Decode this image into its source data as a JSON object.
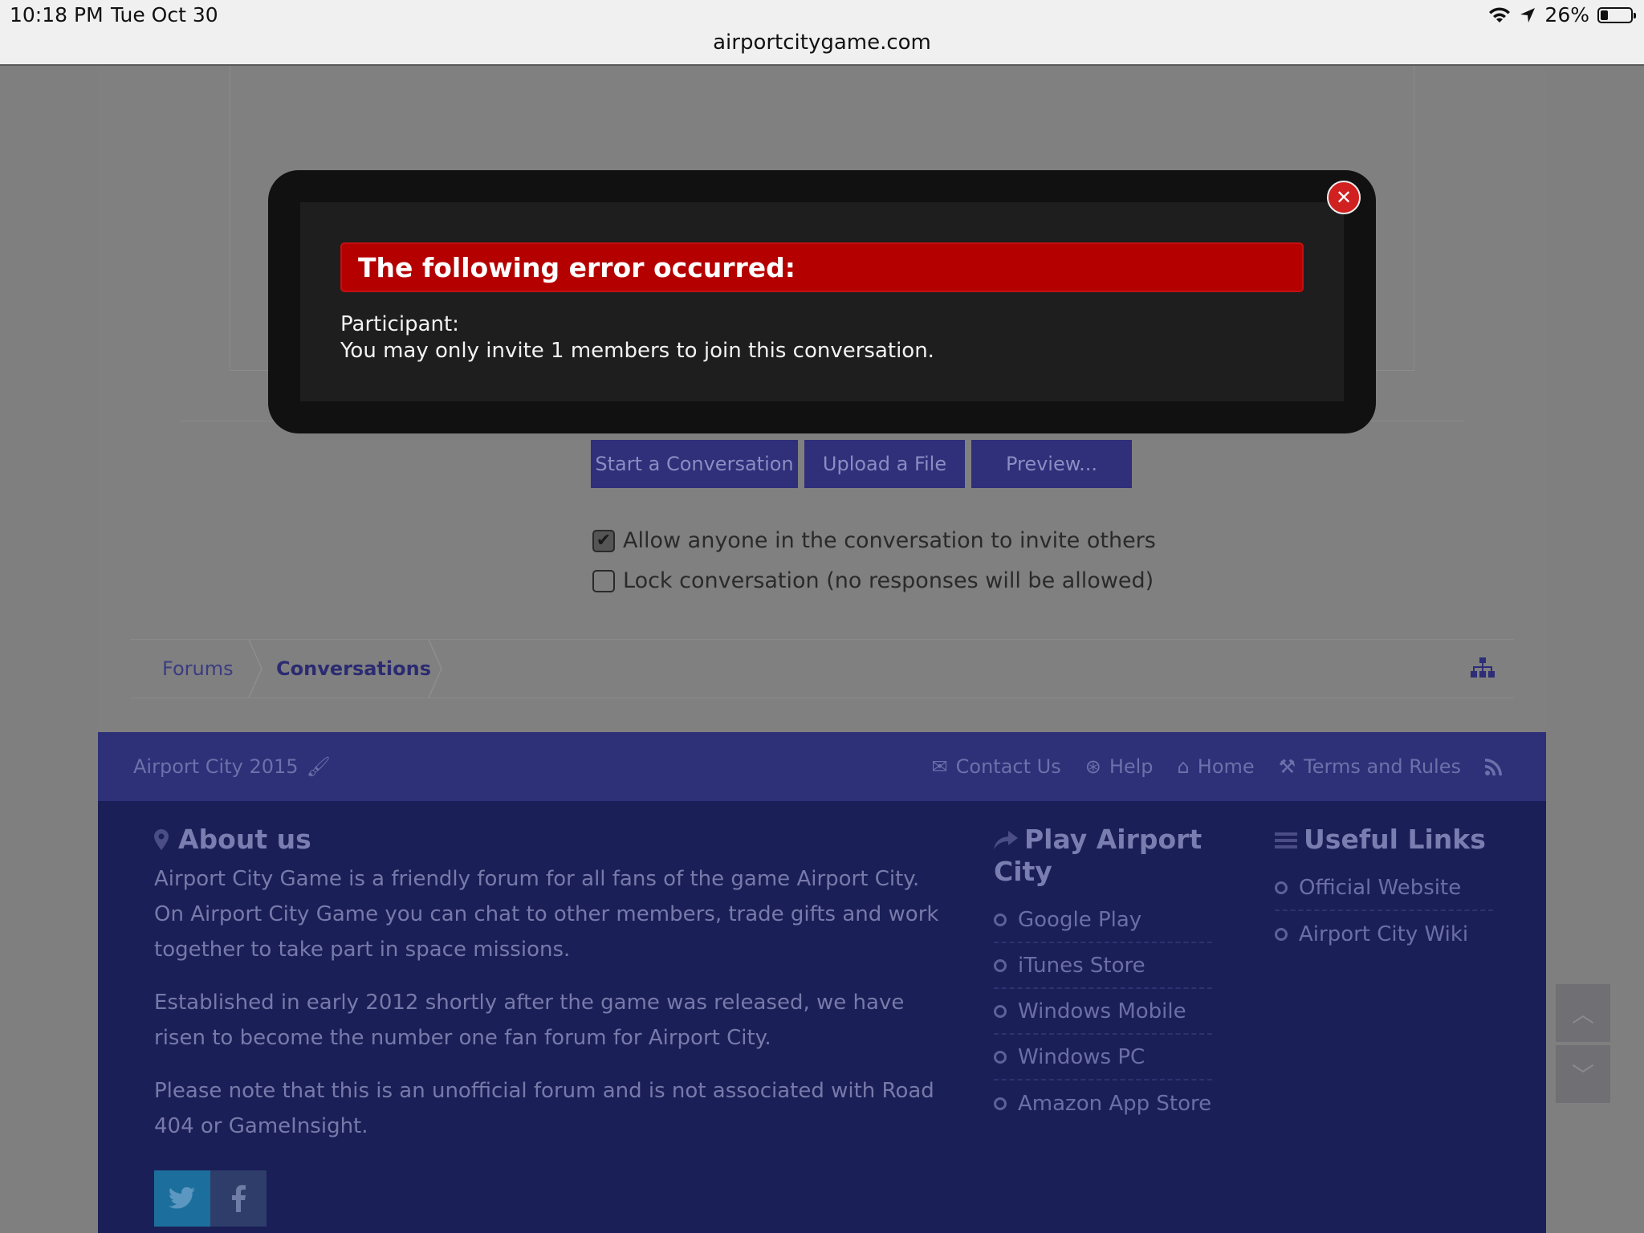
{
  "status_bar": {
    "time": "10:18 PM",
    "date": "Tue Oct 30",
    "url": "airportcitygame.com",
    "battery": "26%",
    "battery_level": 0.26
  },
  "modal": {
    "title": "The following error occurred:",
    "field": "Participant:",
    "message": "You may only invite 1 members to join this conversation.",
    "close_icon": "close-icon"
  },
  "buttons": {
    "start": "Start a Conversation",
    "upload": "Upload a File",
    "preview": "Preview..."
  },
  "options": [
    {
      "label": "Allow anyone in the conversation to invite others",
      "checked": true
    },
    {
      "label": "Lock conversation (no responses will be allowed)",
      "checked": false
    }
  ],
  "breadcrumb": {
    "items": [
      "Forums",
      "Conversations"
    ]
  },
  "footer_bar": {
    "site": "Airport City 2015",
    "links": [
      "Contact Us",
      "Help",
      "Home",
      "Terms and Rules"
    ]
  },
  "about": {
    "title": "About us",
    "paragraphs": [
      "Airport City Game is a friendly forum for all fans of the game Airport City. On Airport City Game you can chat to other members, trade gifts and work together to take part in space missions.",
      "Established in early 2012 shortly after the game was released, we have risen to become the number one fan forum for Airport City.",
      "Please note that this is an unofficial forum and is not associated with Road 404 or GameInsight."
    ]
  },
  "play": {
    "title": "Play Airport City",
    "links": [
      "Google Play",
      "iTunes Store",
      "Windows Mobile",
      "Windows PC",
      "Amazon App Store"
    ]
  },
  "useful": {
    "title": "Useful Links",
    "links": [
      "Official Website",
      "Airport City Wiki"
    ]
  },
  "colors": {
    "error_red": "#b50000",
    "button_navy": "#2f2f7a",
    "footer_navy": "#1b1f57"
  }
}
